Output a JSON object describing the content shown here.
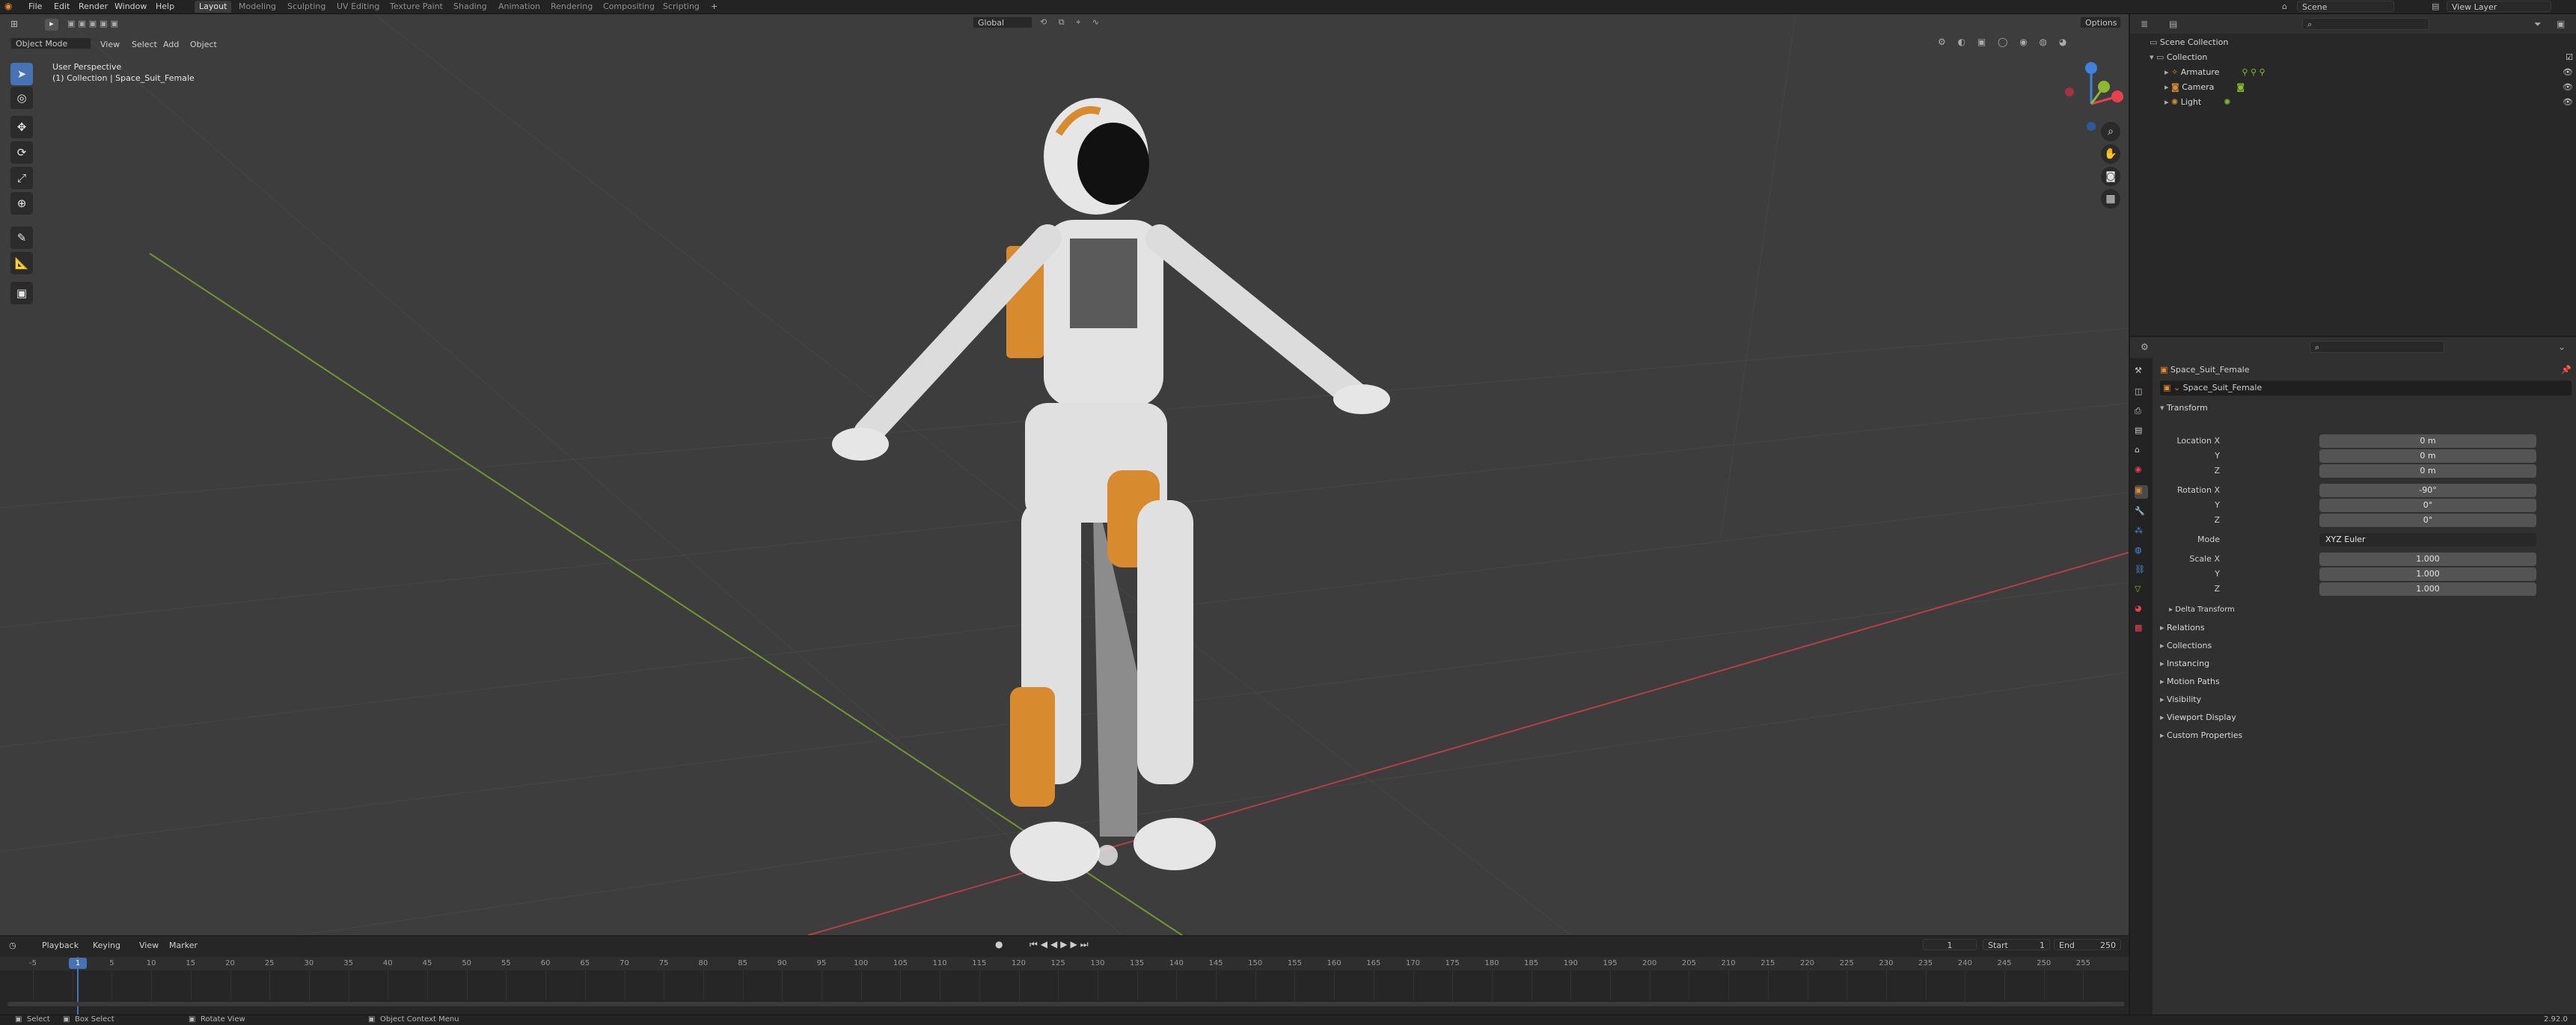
{
  "menu": {
    "items": [
      "File",
      "Edit",
      "Render",
      "Window",
      "Help"
    ],
    "workspaces": [
      "Layout",
      "Modeling",
      "Sculpting",
      "UV Editing",
      "Texture Paint",
      "Shading",
      "Animation",
      "Rendering",
      "Compositing",
      "Scripting"
    ],
    "active_workspace": "Layout",
    "add_tab": "+",
    "scene": "Scene",
    "view_layer": "View Layer"
  },
  "viewport": {
    "mode": "Object Mode",
    "menus": [
      "View",
      "Select",
      "Add",
      "Object"
    ],
    "orientation": "Global",
    "options": "Options",
    "perspective_label": "User Perspective",
    "collection_label": "(1) Collection | Space_Suit_Female",
    "gizmo": {
      "x": "X",
      "y": "Y",
      "z": "Z"
    }
  },
  "timeline": {
    "menus": [
      "Playback",
      "Keying",
      "View",
      "Marker"
    ],
    "current_frame": "1",
    "start_label": "Start",
    "start": "1",
    "end_label": "End",
    "end": "250",
    "ticks": [
      "-5",
      "0",
      "5",
      "10",
      "15",
      "20",
      "25",
      "30",
      "35",
      "40",
      "45",
      "50",
      "55",
      "60",
      "65",
      "70",
      "75",
      "80",
      "85",
      "90",
      "95",
      "100",
      "105",
      "110",
      "115",
      "120",
      "125",
      "130",
      "135",
      "140",
      "145",
      "150",
      "155",
      "160",
      "165",
      "170",
      "175",
      "180",
      "185",
      "190",
      "195",
      "200",
      "205",
      "210",
      "215",
      "220",
      "225",
      "230",
      "235",
      "240",
      "245",
      "250",
      "255"
    ]
  },
  "statusbar": {
    "select": "Select",
    "box_select": "Box Select",
    "rotate_view": "Rotate View",
    "context_menu": "Object Context Menu",
    "version": "2.92.0"
  },
  "outliner": {
    "root": "Scene Collection",
    "collection": "Collection",
    "items": [
      "Armature",
      "Camera",
      "Light"
    ]
  },
  "properties": {
    "object_name": "Space_Suit_Female",
    "data_name": "Space_Suit_Female",
    "transform_title": "Transform",
    "location_label": "Location X",
    "location": [
      "0 m",
      "0 m",
      "0 m"
    ],
    "rotation_label": "Rotation X",
    "rotation": [
      "-90°",
      "0°",
      "0°"
    ],
    "mode_label": "Mode",
    "mode_value": "XYZ Euler",
    "scale_label": "Scale X",
    "scale": [
      "1.000",
      "1.000",
      "1.000"
    ],
    "y_label": "Y",
    "z_label": "Z",
    "delta_transform": "Delta Transform",
    "panels": [
      "Relations",
      "Collections",
      "Instancing",
      "Motion Paths",
      "Visibility",
      "Viewport Display",
      "Custom Properties"
    ]
  },
  "colors": {
    "accent": "#4772b3",
    "x_axis": "#e8414e",
    "y_axis": "#8bba30",
    "z_axis": "#3f82dd",
    "playhead": "#4772b3",
    "suit_orange": "#d88a2e"
  },
  "icons": [
    "blender-logo-icon",
    "cursor-icon",
    "move-icon",
    "rotate-icon",
    "scale-icon",
    "transform-icon",
    "annotate-icon",
    "measure-icon",
    "add-cube-icon",
    "zoom-icon",
    "hand-icon",
    "camera-icon",
    "grid-icon",
    "search-icon",
    "filter-icon",
    "eye-icon",
    "pin-icon",
    "play-icon",
    "wrench-icon"
  ]
}
